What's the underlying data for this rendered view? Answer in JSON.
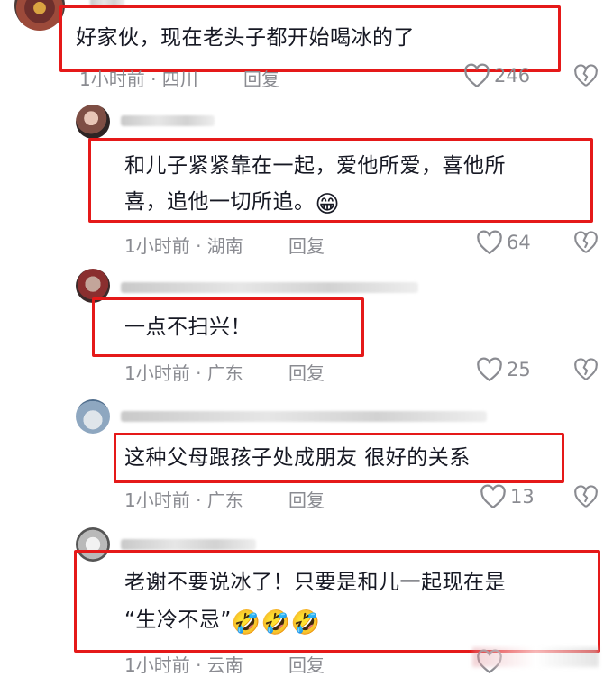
{
  "comments": [
    {
      "text": "好家伙，现在老头子都开始喝冰的了",
      "time_location": "1小时前 · 四川",
      "reply": "回复",
      "likes": "246"
    },
    {
      "text_line1": "和儿子紧紧靠在一起，爱他所爱，喜他所",
      "text_line2": "喜，追他一切所追。",
      "emoji": "😁",
      "time_location": "1小时前 · 湖南",
      "reply": "回复",
      "likes": "64"
    },
    {
      "text": "一点不扫兴！",
      "time_location": "1小时前 · 广东",
      "reply": "回复",
      "likes": "25"
    },
    {
      "text": "这种父母跟孩子处成朋友  很好的关系",
      "time_location": "1小时前 · 广东",
      "reply": "回复",
      "likes": "13"
    },
    {
      "text_line1": "老谢不要说冰了！只要是和儿一起现在是",
      "text_line2": "“生冷不忌”",
      "emoji": "🤣🤣🤣",
      "time_location": "1小时前 · 云南",
      "reply": "回复"
    }
  ],
  "icons": {
    "like": "heart-outline-icon",
    "dislike": "broken-heart-icon"
  },
  "colors": {
    "highlight_box": "#e51919",
    "meta_text": "#8a8b91",
    "body_text": "#161823"
  }
}
